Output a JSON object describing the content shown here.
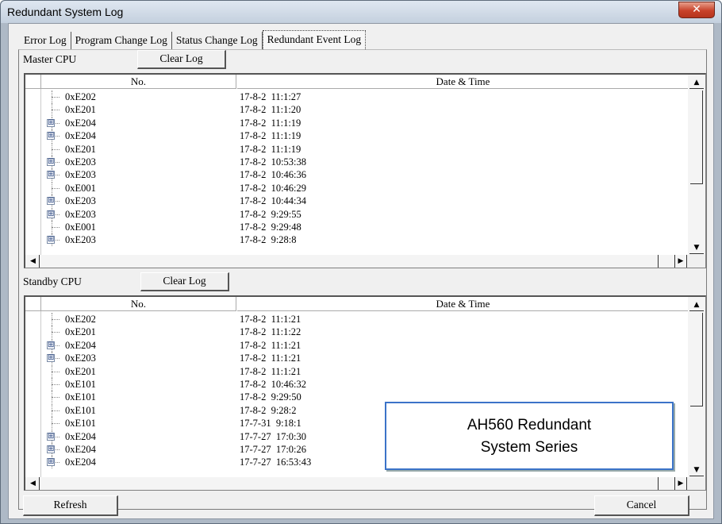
{
  "window": {
    "title": "Redundant System Log",
    "close_glyph": "✕"
  },
  "tabs": [
    {
      "label": "Error Log",
      "active": false
    },
    {
      "label": "Program Change Log",
      "active": false
    },
    {
      "label": "Status Change Log",
      "active": false
    },
    {
      "label": "Redundant Event Log",
      "active": true
    }
  ],
  "columns": {
    "no": "No.",
    "datetime": "Date & Time"
  },
  "master": {
    "label": "Master CPU",
    "clear_label": "Clear Log",
    "rows": [
      {
        "code": "0xE202",
        "datetime": "17-8-2  11:1:27",
        "expandable": false
      },
      {
        "code": "0xE201",
        "datetime": "17-8-2  11:1:20",
        "expandable": false
      },
      {
        "code": "0xE204",
        "datetime": "17-8-2  11:1:19",
        "expandable": true
      },
      {
        "code": "0xE204",
        "datetime": "17-8-2  11:1:19",
        "expandable": true
      },
      {
        "code": "0xE201",
        "datetime": "17-8-2  11:1:19",
        "expandable": false
      },
      {
        "code": "0xE203",
        "datetime": "17-8-2  10:53:38",
        "expandable": true
      },
      {
        "code": "0xE203",
        "datetime": "17-8-2  10:46:36",
        "expandable": true
      },
      {
        "code": "0xE001",
        "datetime": "17-8-2  10:46:29",
        "expandable": false
      },
      {
        "code": "0xE203",
        "datetime": "17-8-2  10:44:34",
        "expandable": true
      },
      {
        "code": "0xE203",
        "datetime": "17-8-2  9:29:55",
        "expandable": true
      },
      {
        "code": "0xE001",
        "datetime": "17-8-2  9:29:48",
        "expandable": false
      },
      {
        "code": "0xE203",
        "datetime": "17-8-2  9:28:8",
        "expandable": true
      }
    ]
  },
  "standby": {
    "label": "Standby CPU",
    "clear_label": "Clear Log",
    "rows": [
      {
        "code": "0xE202",
        "datetime": "17-8-2  11:1:21",
        "expandable": false
      },
      {
        "code": "0xE201",
        "datetime": "17-8-2  11:1:22",
        "expandable": false
      },
      {
        "code": "0xE204",
        "datetime": "17-8-2  11:1:21",
        "expandable": true
      },
      {
        "code": "0xE203",
        "datetime": "17-8-2  11:1:21",
        "expandable": true
      },
      {
        "code": "0xE201",
        "datetime": "17-8-2  11:1:21",
        "expandable": false
      },
      {
        "code": "0xE101",
        "datetime": "17-8-2  10:46:32",
        "expandable": false
      },
      {
        "code": "0xE101",
        "datetime": "17-8-2  9:29:50",
        "expandable": false
      },
      {
        "code": "0xE101",
        "datetime": "17-8-2  9:28:2",
        "expandable": false
      },
      {
        "code": "0xE101",
        "datetime": "17-7-31  9:18:1",
        "expandable": false
      },
      {
        "code": "0xE204",
        "datetime": "17-7-27  17:0:30",
        "expandable": true
      },
      {
        "code": "0xE204",
        "datetime": "17-7-27  17:0:26",
        "expandable": true
      },
      {
        "code": "0xE204",
        "datetime": "17-7-27  16:53:43",
        "expandable": true
      }
    ]
  },
  "buttons": {
    "refresh": "Refresh",
    "cancel": "Cancel"
  },
  "callout": {
    "line1": "AH560 Redundant",
    "line2": "System Series"
  },
  "icons": {
    "expand": "⊞",
    "scroll_up": "▲",
    "scroll_down": "▼",
    "scroll_left": "◀",
    "scroll_right": "▶"
  },
  "colors": {
    "callout_border": "#3b73c8",
    "close_button": "#c8422a"
  }
}
